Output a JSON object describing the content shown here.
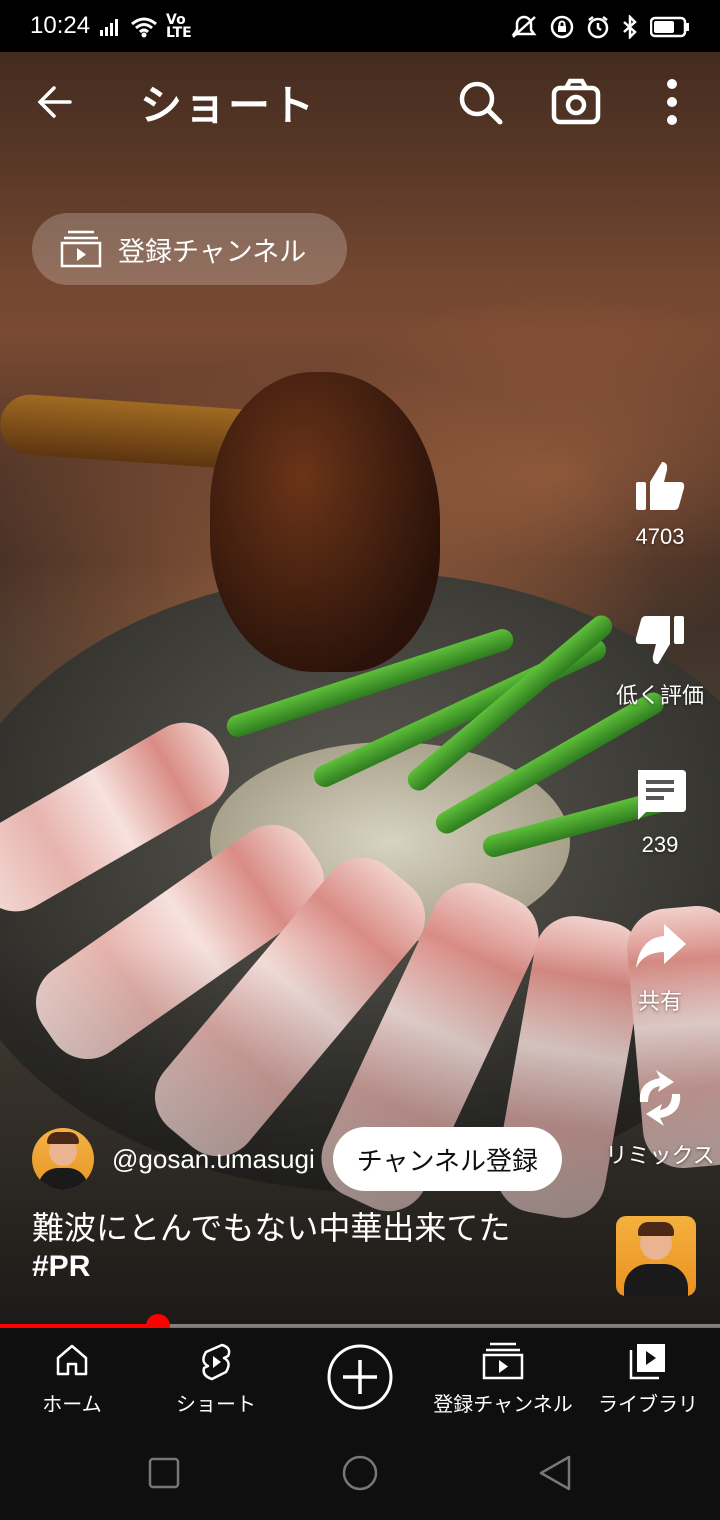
{
  "status": {
    "time": "10:24",
    "network": "Vo LTE"
  },
  "header": {
    "title": "ショート"
  },
  "subscriptions_chip": {
    "label": "登録チャンネル"
  },
  "actions": {
    "like_count": "4703",
    "dislike_label": "低く評価",
    "comment_count": "239",
    "share_label": "共有",
    "remix_label": "リミックス"
  },
  "video": {
    "channel_handle": "@gosan.umasugi",
    "subscribe_label": "チャンネル登録",
    "caption": "難波にとんでもない中華出来てた",
    "hashtag": "#PR",
    "progress": 0.22
  },
  "bottom_nav": {
    "items": [
      {
        "label": "ホーム",
        "icon": "home-icon"
      },
      {
        "label": "ショート",
        "icon": "shorts-icon"
      },
      {
        "label": "",
        "icon": "create-icon"
      },
      {
        "label": "登録チャンネル",
        "icon": "subscriptions-icon"
      },
      {
        "label": "ライブラリ",
        "icon": "library-icon"
      }
    ]
  },
  "colors": {
    "accent": "#ff0000",
    "nav_bg": "#0f0f0f"
  }
}
